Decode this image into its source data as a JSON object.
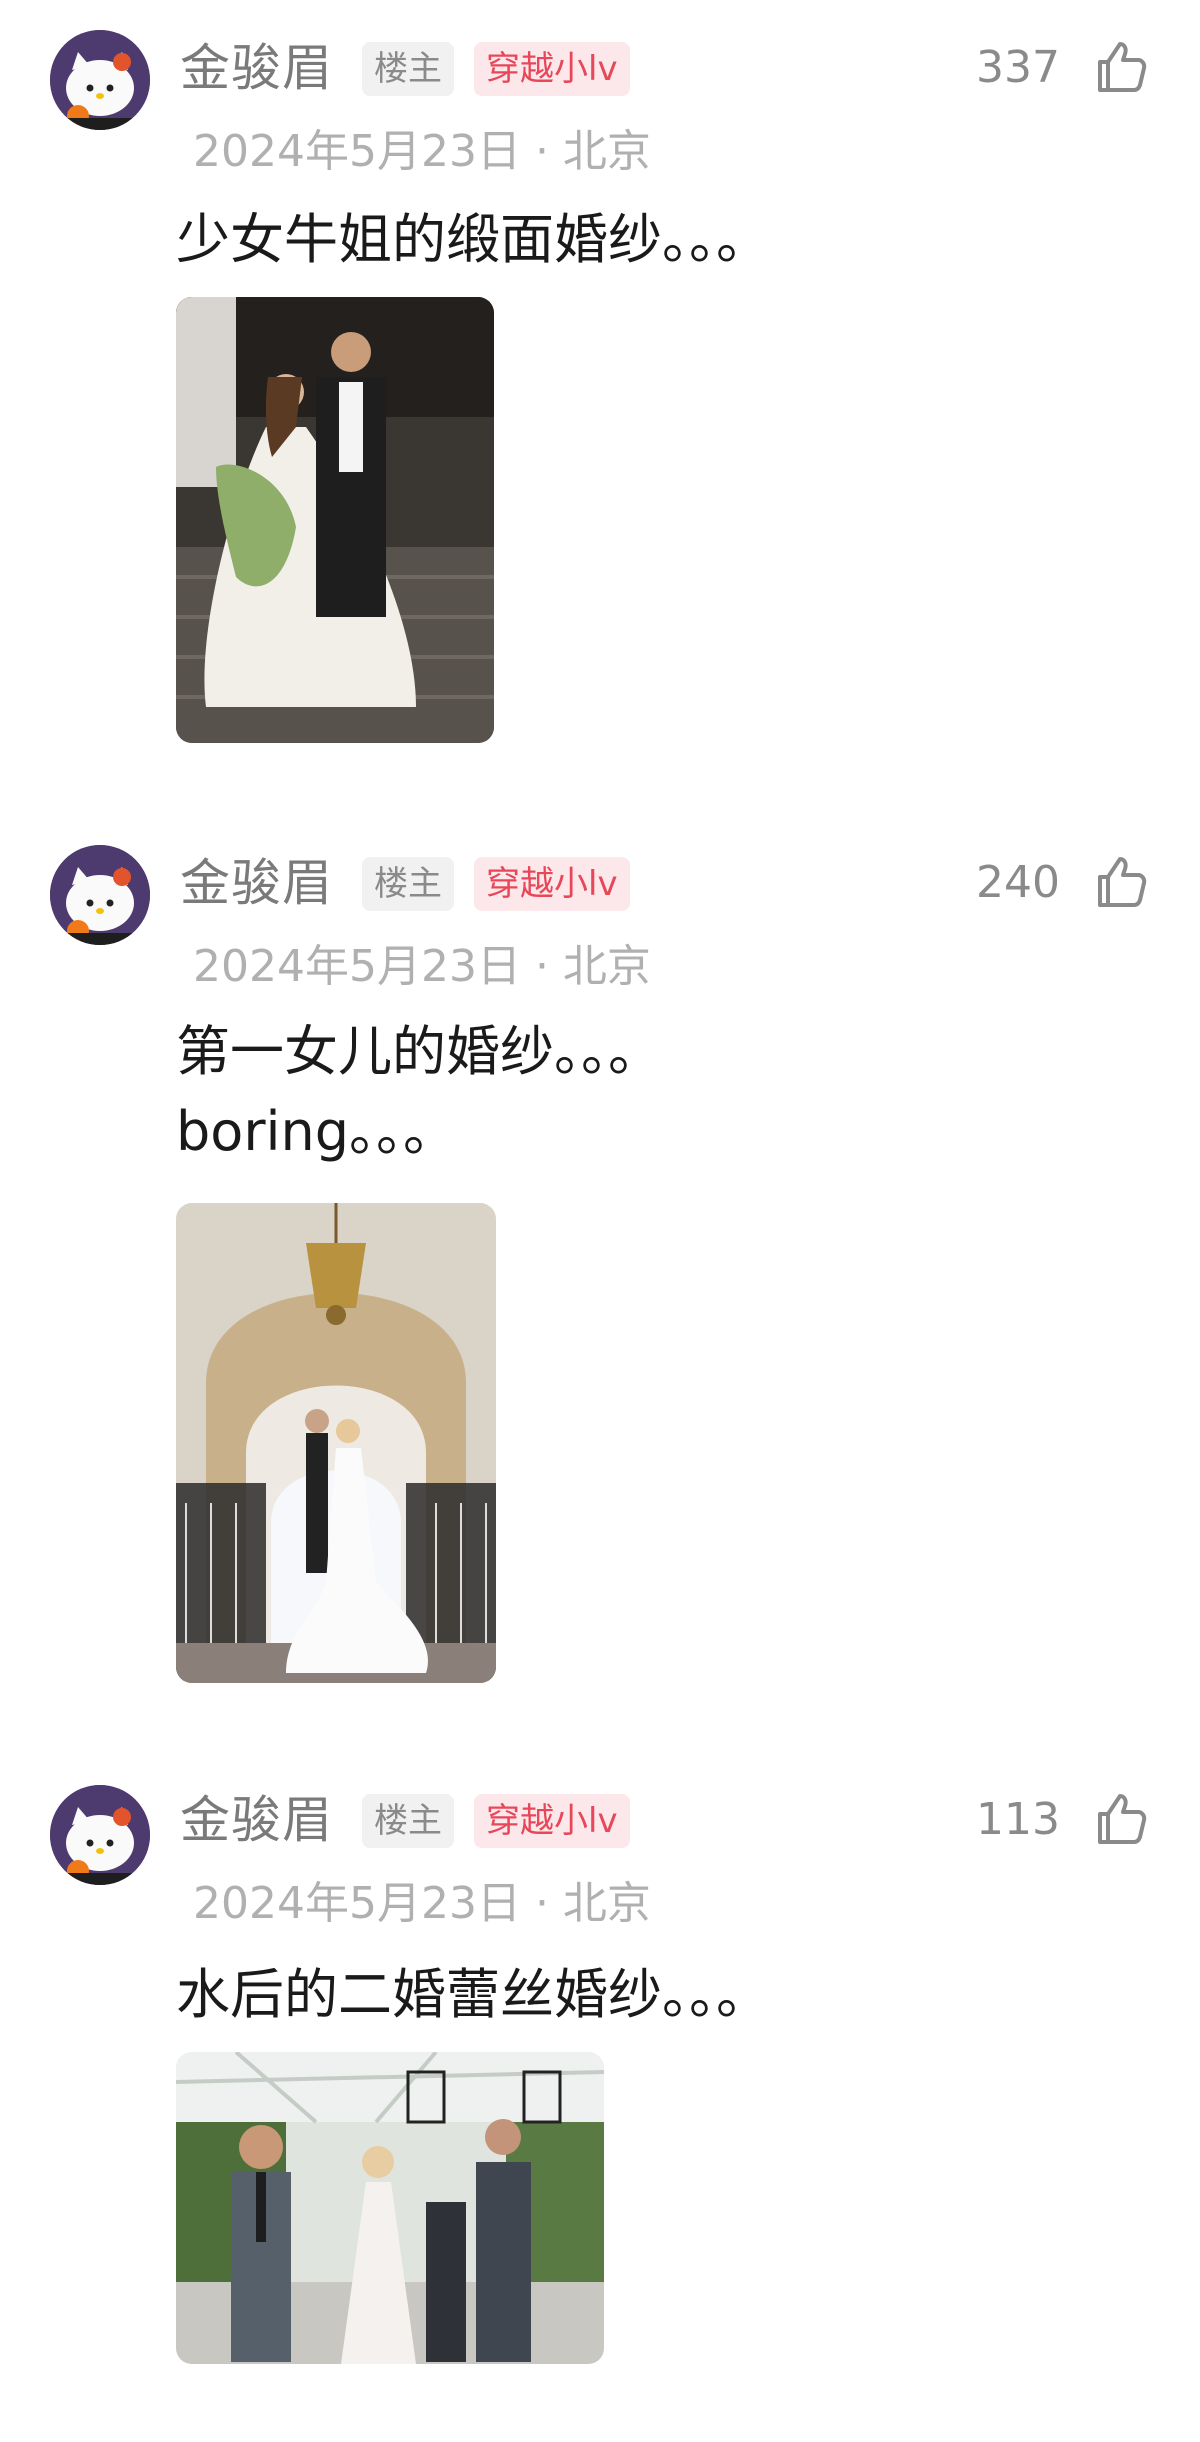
{
  "comments": [
    {
      "username": "金骏眉",
      "op_tag": "楼主",
      "badge": "穿越小lv",
      "likes": "337",
      "meta": "2024年5月23日 · 北京",
      "text": "少女牛姐的缎面婚纱。。。",
      "image": "wedding-photo-satin-gown"
    },
    {
      "username": "金骏眉",
      "op_tag": "楼主",
      "badge": "穿越小lv",
      "likes": "240",
      "meta": "2024年5月23日 · 北京",
      "text": "第一女儿的婚纱。。。\nboring。。。",
      "image": "wedding-photo-staircase"
    },
    {
      "username": "金骏眉",
      "op_tag": "楼主",
      "badge": "穿越小lv",
      "likes": "113",
      "meta": "2024年5月23日 · 北京",
      "text": "水后的二婚蕾丝婚纱。。。",
      "image": "wedding-photo-lace-gown"
    }
  ],
  "colors": {
    "username": "#7a7a7a",
    "op_tag_bg": "#f1f1f1",
    "badge_text": "#e8475a",
    "badge_bg": "#fce8ea",
    "meta": "#b0b0b0",
    "text": "#1a1a1a"
  },
  "icons": [
    "hello-kitty-avatar",
    "thumbs-up-icon"
  ]
}
